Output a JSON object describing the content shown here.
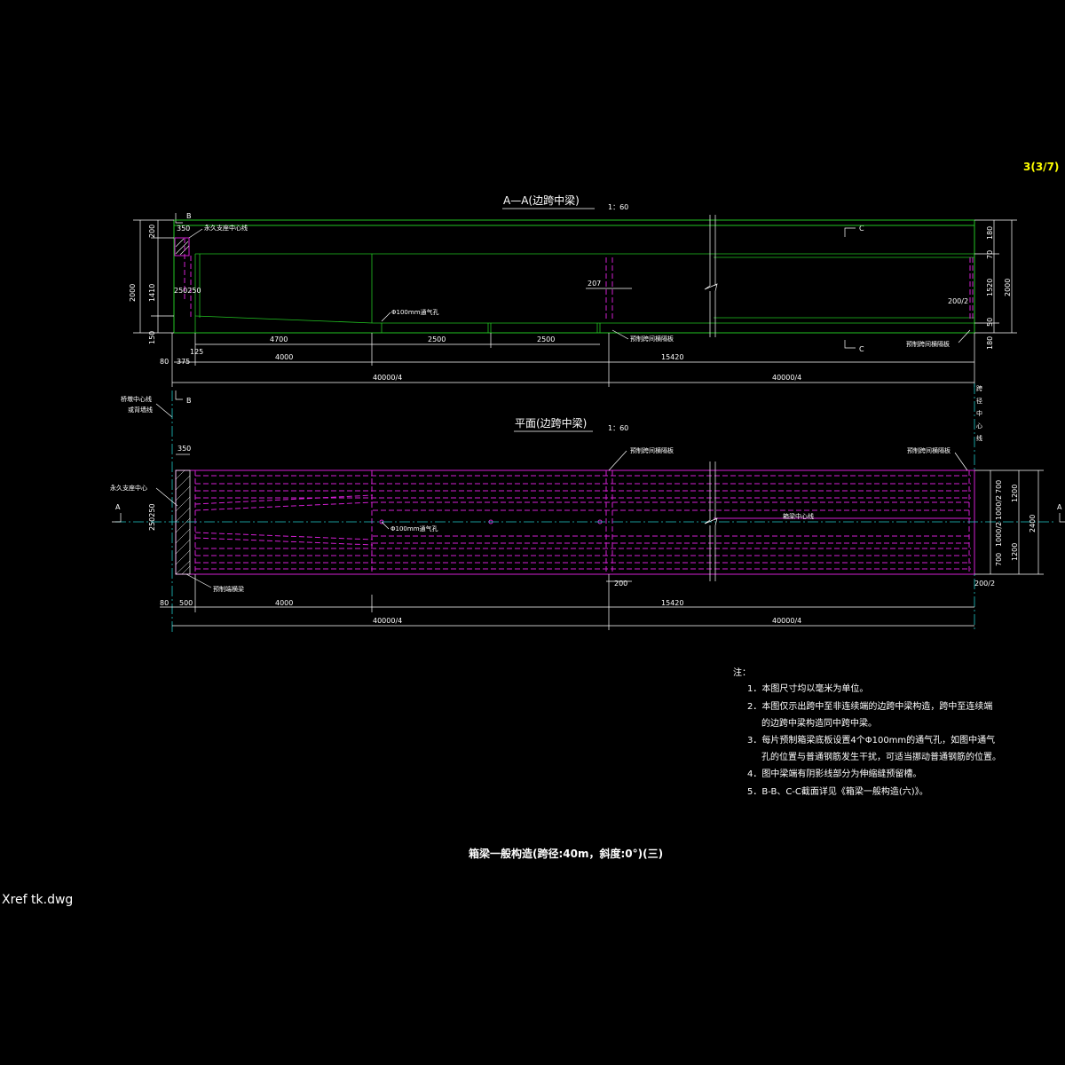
{
  "sheet_number": "3(3/7)",
  "xref_label": "Xref tk.dwg",
  "colors": {
    "background": "#000000",
    "beam": "#22c322",
    "tendon": "#d21fd2",
    "sheet_number": "#ffff00",
    "centerline": "#20c8c8",
    "text": "#ffffff"
  },
  "section": {
    "title": "A—A(边跨中梁)",
    "scale": "1：60",
    "marker_b": "B",
    "marker_c_top": "C",
    "marker_c_bottom": "C",
    "label_support_centerline": "永久支座中心线",
    "label_vent_hole": "Φ100mm通气孔",
    "label_diaphragm": "预制跨间横隔板",
    "label_diaphragm_end": "预制跨间横隔板",
    "dims": {
      "top_350": "350",
      "left_2000": "2000",
      "left_1410": "1410",
      "left_200": "200",
      "left_250": "250",
      "left_150": "150",
      "web_250_250": "250250",
      "right_180_top": "180",
      "right_70": "70",
      "right_1520": "1520",
      "right_2000": "2000",
      "right_50": "50",
      "right_180_bottom": "180",
      "d207": "207",
      "d200_2": "200/2",
      "d125": "125",
      "d4700": "4700",
      "d2500a": "2500",
      "d2500b": "2500",
      "d80": "80",
      "d375": "375",
      "d4000": "4000",
      "d15420": "15420",
      "half_a": "40000/4",
      "half_b": "40000/4"
    }
  },
  "plan": {
    "title": "平面(边跨中梁)",
    "scale": "1：60",
    "marker_b": "B",
    "marker_a_left": "A",
    "marker_a_right": "A",
    "label_pier_centerline_1": "桥墩中心线",
    "label_pier_centerline_2": "或背墙线",
    "label_span_centerline": [
      "跨",
      "径",
      "中",
      "心",
      "线"
    ],
    "label_support_center": "永久支座中心",
    "label_diaphragm_1": "预制跨间横隔板",
    "label_diaphragm_2": "预制跨间横隔板",
    "label_beam_centerline": "箱梁中心线",
    "label_vent_hole": "Φ100mm通气孔",
    "label_end_beam": "预制端横梁",
    "dims": {
      "top_350": "350",
      "left_250": "250250",
      "d200": "200",
      "d200_2": "200/2",
      "r700_top": "700",
      "r1000_2_top": "1000/2",
      "r1200_top": "1200",
      "r2400": "2400",
      "r1000_2_bot": "1000/2",
      "r700_bot": "700",
      "r1200_bot": "1200",
      "d80": "80",
      "d500": "500",
      "d4000": "4000",
      "d15420": "15420",
      "half_a": "40000/4",
      "half_b": "40000/4"
    }
  },
  "notes": {
    "heading": "注：",
    "items": [
      "1．本图尺寸均以毫米为单位。",
      "2．本图仅示出跨中至非连续端的边跨中梁构造，跨中至连续端",
      "的边跨中梁构造同中跨中梁。",
      "3．每片预制箱梁底板设置4个Φ100mm的通气孔，如图中通气",
      "孔的位置与普通钢筋发生干扰，可适当挪动普通钢筋的位置。",
      "4．图中梁端有阴影线部分为伸缩缝预留槽。",
      "5．B-B、C-C截面详见《箱梁一般构造(六)》。"
    ]
  },
  "drawing_title": "箱梁一般构造(跨径:40m，斜度:0°)(三)"
}
